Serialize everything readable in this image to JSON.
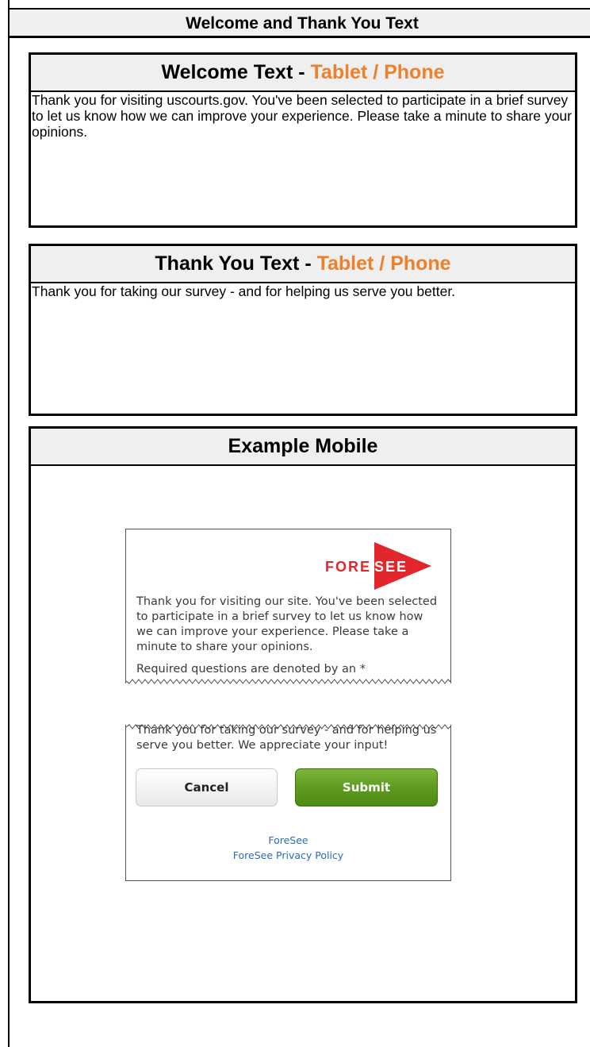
{
  "page": {
    "title": "Welcome and Thank You Text"
  },
  "welcome": {
    "heading": "Welcome Text - ",
    "heading_accent": "Tablet / Phone",
    "body": "Thank you for visiting uscourts.gov. You've been selected to participate in a brief survey to let us know how we can improve your experience. Please take a minute to share your opinions."
  },
  "thanks": {
    "heading": "Thank You Text - ",
    "heading_accent": "Tablet / Phone",
    "body": "Thank you for taking our survey - and for helping us serve you better."
  },
  "example": {
    "heading": "Example Mobile",
    "logo_text_left": "FORE",
    "logo_text_right": "SEE",
    "welcome_text": "Thank you for visiting our site. You've been selected to participate in a brief survey to let us know how we can improve your experience. Please take a minute to share your opinions.",
    "required_note": "Required questions are denoted by an *",
    "thanks_text": "Thank you for taking our survey - and for helping us serve you better. We appreciate your input!",
    "cancel_label": "Cancel",
    "submit_label": "Submit",
    "link_foresee": "ForeSee",
    "link_privacy": "ForeSee Privacy Policy"
  },
  "colors": {
    "accent": "#ee7f2d",
    "brand_red": "#e3262b",
    "submit_green": "#5f9a21",
    "link_blue": "#2a6db5"
  }
}
